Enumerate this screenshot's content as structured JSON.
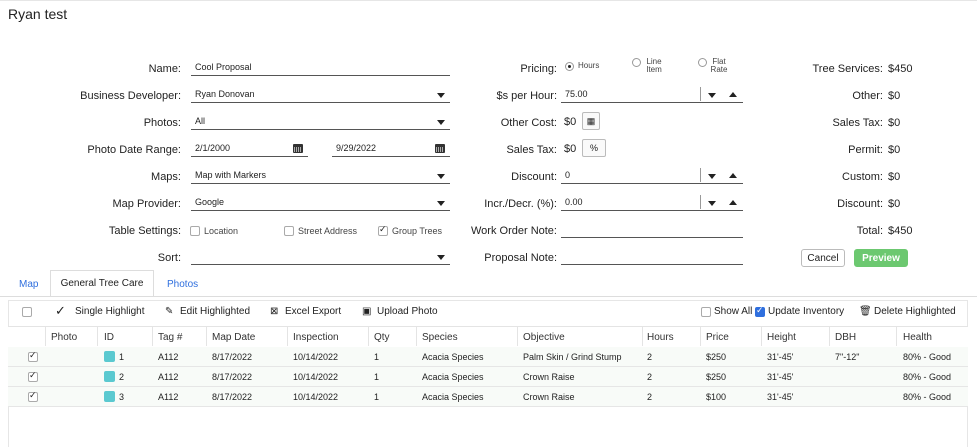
{
  "page": {
    "title": "Ryan test"
  },
  "form": {
    "name_label": "Name:",
    "name_value": "Cool Proposal",
    "bizdev_label": "Business Developer:",
    "bizdev_value": "Ryan Donovan",
    "photos_label": "Photos:",
    "photos_value": "All",
    "daterange_label": "Photo Date Range:",
    "date_from": "2/1/2000",
    "date_to": "9/29/2022",
    "maps_label": "Maps:",
    "maps_value": "Map with Markers",
    "provider_label": "Map Provider:",
    "provider_value": "Google",
    "table_settings_label": "Table Settings:",
    "opt_location": "Location",
    "opt_street": "Street Address",
    "opt_group": "Group Trees",
    "sort_label": "Sort:",
    "sort_value": ""
  },
  "pricing": {
    "pricing_label": "Pricing:",
    "opt_hours": "Hours",
    "opt_line_1": "Line",
    "opt_line_2": "Item",
    "opt_flat_1": "Flat",
    "opt_flat_2": "Rate",
    "per_hour_label": "$s per Hour:",
    "per_hour_value": "75.00",
    "other_cost_label": "Other Cost:",
    "other_cost_value": "$0",
    "sales_tax_label": "Sales Tax:",
    "sales_tax_value": "$0",
    "discount_label": "Discount:",
    "discount_value": "0",
    "incr_label": "Incr./Decr. (%):",
    "incr_value": "0.00",
    "work_order_label": "Work Order Note:",
    "work_order_value": "",
    "proposal_note_label": "Proposal Note:",
    "proposal_note_value": ""
  },
  "summary": {
    "tree_services_label": "Tree Services:",
    "tree_services_value": "$450",
    "other_label": "Other:",
    "other_value": "$0",
    "sales_tax_label": "Sales Tax:",
    "sales_tax_value": "$0",
    "permit_label": "Permit:",
    "permit_value": "$0",
    "custom_label": "Custom:",
    "custom_value": "$0",
    "discount_label": "Discount:",
    "discount_value": "$0",
    "total_label": "Total:",
    "total_value": "$450",
    "cancel_label": "Cancel",
    "preview_label": "Preview"
  },
  "tabs": {
    "map": "Map",
    "general": "General Tree Care",
    "photos": "Photos"
  },
  "toolbar": {
    "single_highlight": "Single Highlight",
    "edit_highlighted": "Edit Highlighted",
    "excel_export": "Excel Export",
    "upload_photo": "Upload Photo",
    "show_all": "Show All",
    "update_inventory": "Update Inventory",
    "delete_highlighted": "Delete Highlighted"
  },
  "table": {
    "columns": [
      "Photo",
      "ID",
      "Tag #",
      "Map Date",
      "Inspection",
      "Qty",
      "Species",
      "Objective",
      "Hours",
      "Price",
      "Height",
      "DBH",
      "Health"
    ],
    "rows": [
      [
        "",
        "1",
        "A112",
        "8/17/2022",
        "10/14/2022",
        "1",
        "Acacia Species",
        "Palm Skin / Grind Stump",
        "2",
        "$250",
        "31'-45'",
        "7\"-12\"",
        "80% - Good"
      ],
      [
        "",
        "2",
        "A112",
        "8/17/2022",
        "10/14/2022",
        "1",
        "Acacia Species",
        "Crown Raise",
        "2",
        "$250",
        "31'-45'",
        "",
        "80% - Good"
      ],
      [
        "",
        "3",
        "A112",
        "8/17/2022",
        "10/14/2022",
        "1",
        "Acacia Species",
        "Crown Raise",
        "2",
        "$100",
        "31'-45'",
        "",
        "80% - Good"
      ]
    ]
  },
  "colors": {
    "accent_blue": "#2f6fde",
    "preview_green": "#6cc870",
    "tree_swatch": "#5bc9d0"
  }
}
